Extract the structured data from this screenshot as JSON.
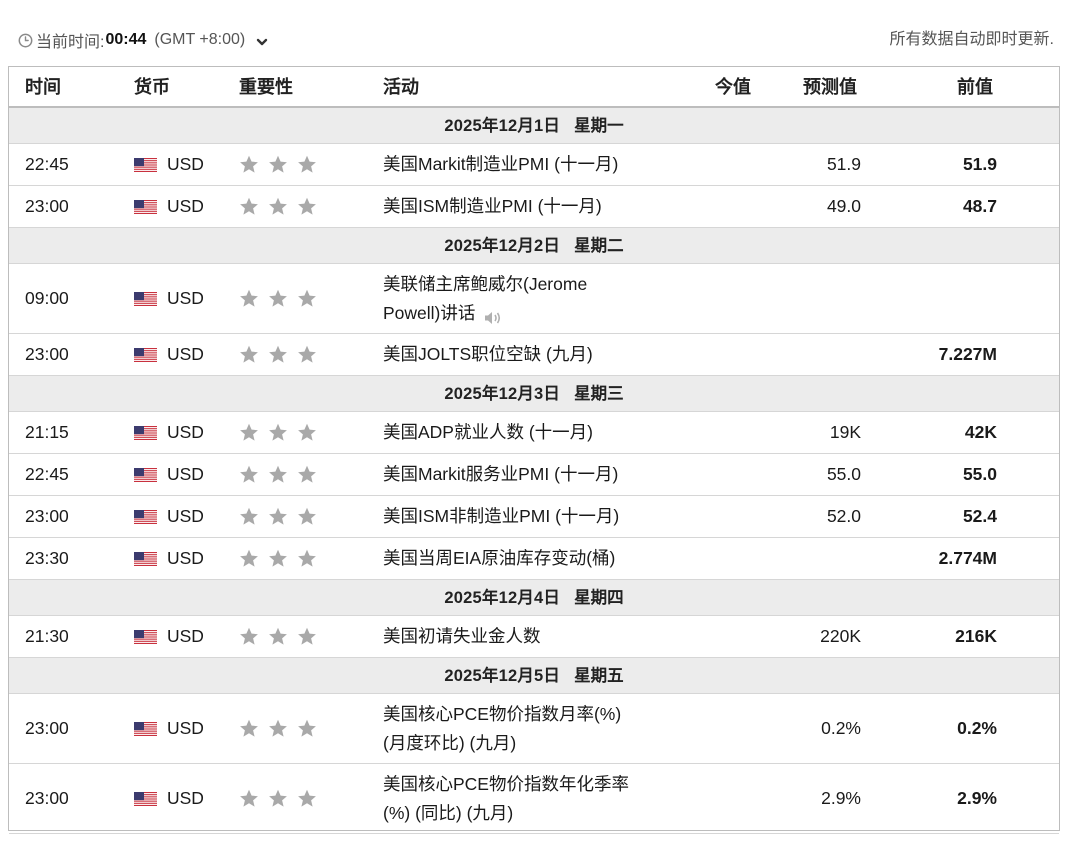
{
  "header": {
    "time_label": "当前时间:",
    "time_value": "00:44",
    "timezone": "(GMT +8:00)",
    "auto_update": "所有数据自动即时更新."
  },
  "columns": {
    "time": "时间",
    "currency": "货币",
    "importance": "重要性",
    "event": "活动",
    "actual": "今值",
    "forecast": "预测值",
    "previous": "前值"
  },
  "days": [
    {
      "date": "2025年12月1日",
      "weekday": "星期一",
      "events": [
        {
          "time": "22:45",
          "currency": "USD",
          "stars": 3,
          "event": "美国Markit制造业PMI (十一月)",
          "actual": "",
          "forecast": "51.9",
          "previous": "51.9"
        },
        {
          "time": "23:00",
          "currency": "USD",
          "stars": 3,
          "event": "美国ISM制造业PMI (十一月)",
          "actual": "",
          "forecast": "49.0",
          "previous": "48.7"
        }
      ]
    },
    {
      "date": "2025年12月2日",
      "weekday": "星期二",
      "events": [
        {
          "time": "09:00",
          "currency": "USD",
          "stars": 3,
          "event_lines": [
            "美联储主席鲍威尔(Jerome",
            "Powell)讲话"
          ],
          "speech": true,
          "actual": "",
          "forecast": "",
          "previous": ""
        },
        {
          "time": "23:00",
          "currency": "USD",
          "stars": 3,
          "event": "美国JOLTS职位空缺 (九月)",
          "actual": "",
          "forecast": "",
          "previous": "7.227M"
        }
      ]
    },
    {
      "date": "2025年12月3日",
      "weekday": "星期三",
      "events": [
        {
          "time": "21:15",
          "currency": "USD",
          "stars": 3,
          "event": "美国ADP就业人数 (十一月)",
          "actual": "",
          "forecast": "19K",
          "previous": "42K"
        },
        {
          "time": "22:45",
          "currency": "USD",
          "stars": 3,
          "event": "美国Markit服务业PMI (十一月)",
          "actual": "",
          "forecast": "55.0",
          "previous": "55.0"
        },
        {
          "time": "23:00",
          "currency": "USD",
          "stars": 3,
          "event": "美国ISM非制造业PMI (十一月)",
          "actual": "",
          "forecast": "52.0",
          "previous": "52.4"
        },
        {
          "time": "23:30",
          "currency": "USD",
          "stars": 3,
          "event": "美国当周EIA原油库存变动(桶)",
          "actual": "",
          "forecast": "",
          "previous": "2.774M"
        }
      ]
    },
    {
      "date": "2025年12月4日",
      "weekday": "星期四",
      "events": [
        {
          "time": "21:30",
          "currency": "USD",
          "stars": 3,
          "event": "美国初请失业金人数",
          "actual": "",
          "forecast": "220K",
          "previous": "216K"
        }
      ]
    },
    {
      "date": "2025年12月5日",
      "weekday": "星期五",
      "events": [
        {
          "time": "23:00",
          "currency": "USD",
          "stars": 3,
          "event_lines": [
            "美国核心PCE物价指数月率(%)",
            "(月度环比) (九月)"
          ],
          "actual": "",
          "forecast": "0.2%",
          "previous": "0.2%"
        },
        {
          "time": "23:00",
          "currency": "USD",
          "stars": 3,
          "event_lines": [
            "美国核心PCE物价指数年化季率",
            "(%) (同比) (九月)"
          ],
          "actual": "",
          "forecast": "2.9%",
          "previous": "2.9%"
        }
      ]
    }
  ],
  "icons": {
    "clock": "clock-icon",
    "dropdown": "chevron-down-icon",
    "flag": "us-flag-icon",
    "star": "star-icon",
    "speaker": "speaker-icon"
  },
  "colors": {
    "star": "#a9a9a9",
    "date_row_bg": "#ececec",
    "border": "#bdbdbd",
    "flag_red": "#c8313e",
    "flag_blue": "#3c3b6e"
  }
}
